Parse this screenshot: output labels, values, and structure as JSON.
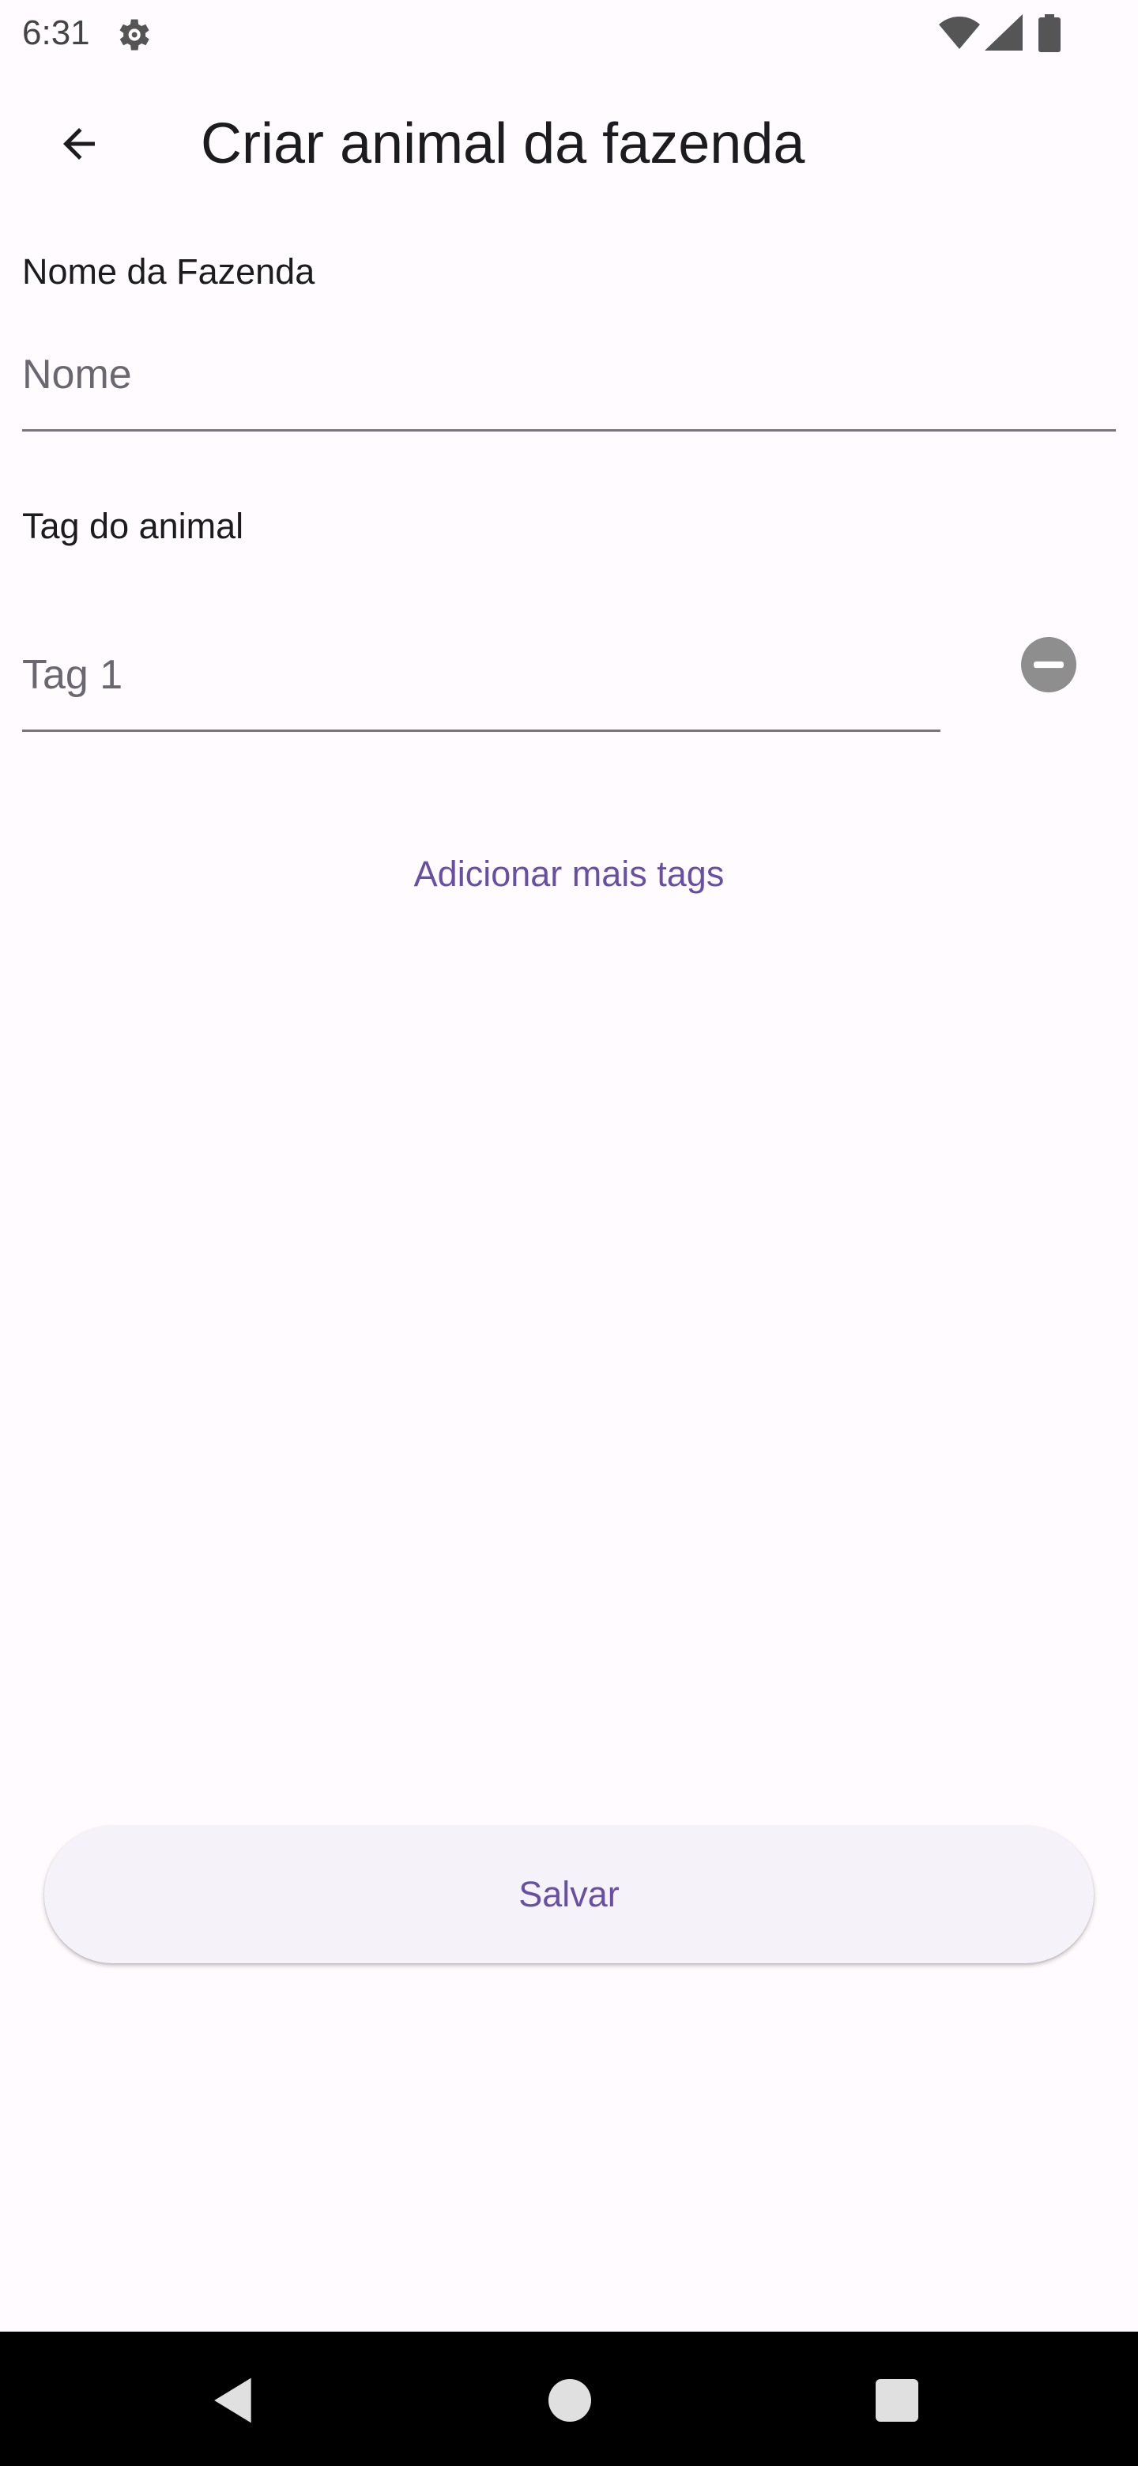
{
  "status_bar": {
    "time": "6:31",
    "icons": [
      "gear-icon",
      "wifi-icon",
      "signal-icon",
      "battery-icon"
    ]
  },
  "app_bar": {
    "back_icon": "arrow-left-icon",
    "title": "Criar animal da fazenda"
  },
  "form": {
    "farm_name": {
      "label": "Nome da Fazenda",
      "placeholder": "Nome",
      "value": ""
    },
    "animal_tag": {
      "label": "Tag do animal",
      "tags": [
        {
          "placeholder": "Tag 1",
          "value": "",
          "remove_icon": "remove-circle-icon"
        }
      ]
    },
    "add_tags_label": "Adicionar mais tags",
    "save_label": "Salvar"
  },
  "nav_bar": {
    "icons": [
      "nav-back-icon",
      "nav-home-icon",
      "nav-recents-icon"
    ]
  },
  "colors": {
    "background": "#fffbfe",
    "primary": "#6750a4",
    "text": "#1c1b1f",
    "underline": "#79747e",
    "button_surface": "#f6f2f9",
    "remove_icon": "#8e8e8e"
  }
}
